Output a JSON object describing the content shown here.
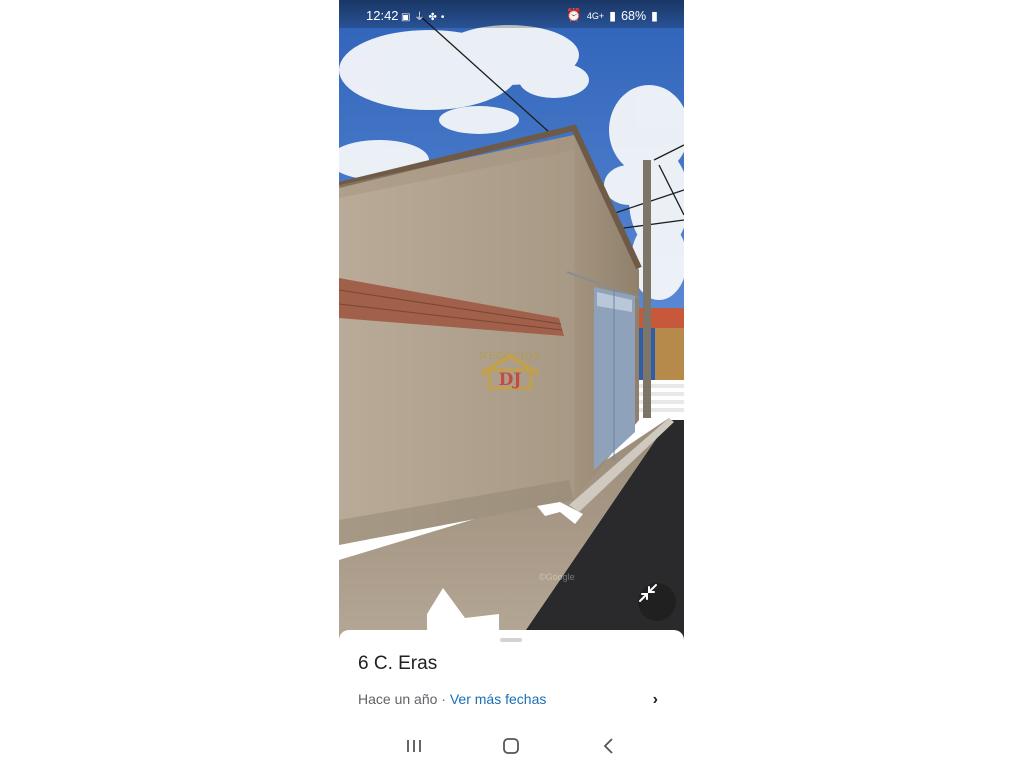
{
  "status_bar": {
    "time": "12:42",
    "left_icons": [
      "image-icon",
      "mic-icon",
      "fan-icon",
      "dot-icon"
    ],
    "network": "4G+",
    "battery": "68%",
    "right_icons": [
      "alarm-icon",
      "network-4g-icon",
      "signal-icon",
      "battery-icon"
    ]
  },
  "street_view": {
    "watermark_brand": "NEGOCIOS",
    "overlay_mark": "©Google",
    "nav_arrows": [
      "chevron-up-icon",
      "chevron-up-icon"
    ],
    "collapse_icon": "minimize-icon"
  },
  "sheet": {
    "title": "6 C. Eras",
    "date_text": "Hace un año",
    "separator": " · ",
    "more_dates_link": "Ver más fechas",
    "chevron": "›"
  },
  "system_nav": {
    "buttons": [
      "recent-apps-icon",
      "home-icon",
      "back-icon"
    ]
  },
  "colors": {
    "link": "#1a6fb5",
    "sky": "#3f74c8",
    "wall": "#b3a595"
  }
}
